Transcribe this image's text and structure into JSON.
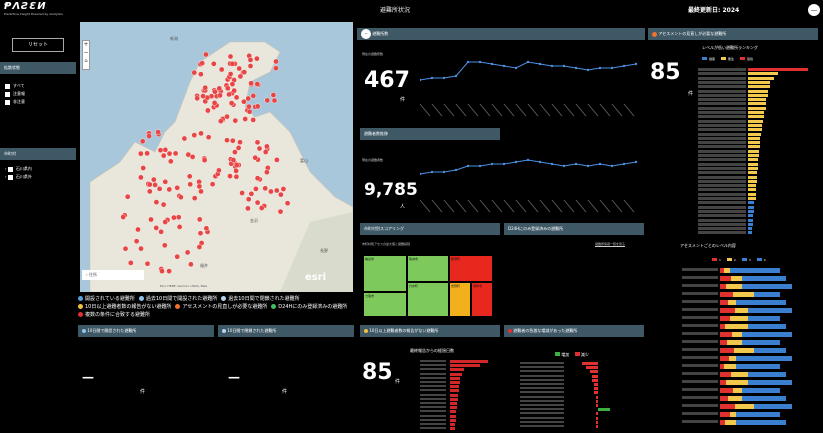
{
  "header": {
    "logo_main": "ⱣΛƧƐИ",
    "logo_sub": "Predictive Insight Powered by Analytics",
    "title": "避難所状況",
    "updated": "最終更新日: 2024",
    "user_initial": "—"
  },
  "sidebar": {
    "reset_label": "リセット",
    "section1_title": "拡散状態",
    "filters": [
      "すべて",
      "注意報",
      "非注意"
    ],
    "section2_title": "市町村",
    "cities": [
      "石川県内",
      "石川県外"
    ]
  },
  "map": {
    "search_placeholder": "住所",
    "zoom_in": "+",
    "zoom_out": "−",
    "attribution": "Esri, HERE, Garmin, USGS, NGA",
    "esri_label": "esri",
    "place_labels": [
      "新潟",
      "富山",
      "金沢",
      "福井",
      "長野"
    ]
  },
  "map_legend": [
    {
      "label": "開設されている避難所",
      "color": "#4fa3e0"
    },
    {
      "label": "過去10日間で開設された避難所",
      "color": "#8fc4ea"
    },
    {
      "label": "過去10日間で閉鎖された避難所",
      "color": "#b5d5f0"
    },
    {
      "label": "10日以上避難者数の報告がない避難所",
      "color": "#f0c040"
    },
    {
      "label": "アセスメントの見直しが必要な避難所",
      "color": "#f07030"
    },
    {
      "label": "D24Hにのみ登録済みの避難所",
      "color": "#40c060"
    },
    {
      "label": "複数の条件に合致する避難所",
      "color": "#e03030"
    }
  ],
  "shelters": {
    "header": "避難所数",
    "subtitle": "現在の避難所数",
    "value": "467",
    "unit": "件"
  },
  "evacuees": {
    "header": "避難者数推移",
    "subtitle": "現在の避難者数",
    "value": "9,785",
    "unit": "人"
  },
  "assessment": {
    "header": "アセスメントの見直しが必要な避難所",
    "value": "85",
    "unit": "件",
    "ranking_title": "レベルが低い避難所ランキング",
    "legend": [
      "健康",
      "衛生",
      "環境"
    ],
    "section2_title": "アセスメントごとのレベル内容",
    "legend2": [
      "1",
      "2",
      "3",
      "4"
    ]
  },
  "scoring": {
    "header": "市町村別スコアリング",
    "sub": "市町村別アセスの最大値と避難段階",
    "link": "避難所情報一覧を見る",
    "d24h_header": "D24Hにのみ登録済みの避難所",
    "tiles": [
      {
        "label": "輪島市",
        "color": "#7dc95c"
      },
      {
        "label": "珠洲市",
        "color": "#7dc95c"
      },
      {
        "label": "能登町",
        "color": "#e8281e"
      },
      {
        "label": "七尾市",
        "color": "#7dc95c"
      },
      {
        "label": "穴水町",
        "color": "#7dc95c"
      },
      {
        "label": "志賀町",
        "color": "#f2b01c"
      },
      {
        "label": "羽咋市",
        "color": "#e8281e"
      }
    ]
  },
  "bottom": {
    "p1_header": "10日間で開設された避難所",
    "p1_value": "—",
    "p1_unit": "件",
    "p2_header": "10日間で閉鎖された避難所",
    "p2_value": "—",
    "p2_unit": "件",
    "p3_header": "10日以上避難者数の報告がない避難所",
    "p3_value": "85",
    "p3_unit": "件",
    "p3_chart_title": "最終報告からの経過日数",
    "p4_header": "避難者の急激な増減があった避難所",
    "p4_legend": [
      "増加",
      "減少"
    ]
  },
  "colors": {
    "panel_header": "#3e5866",
    "yellow": "#f2c94c",
    "blue": "#3b7fd0",
    "red": "#e03030",
    "green": "#3cb043"
  }
}
